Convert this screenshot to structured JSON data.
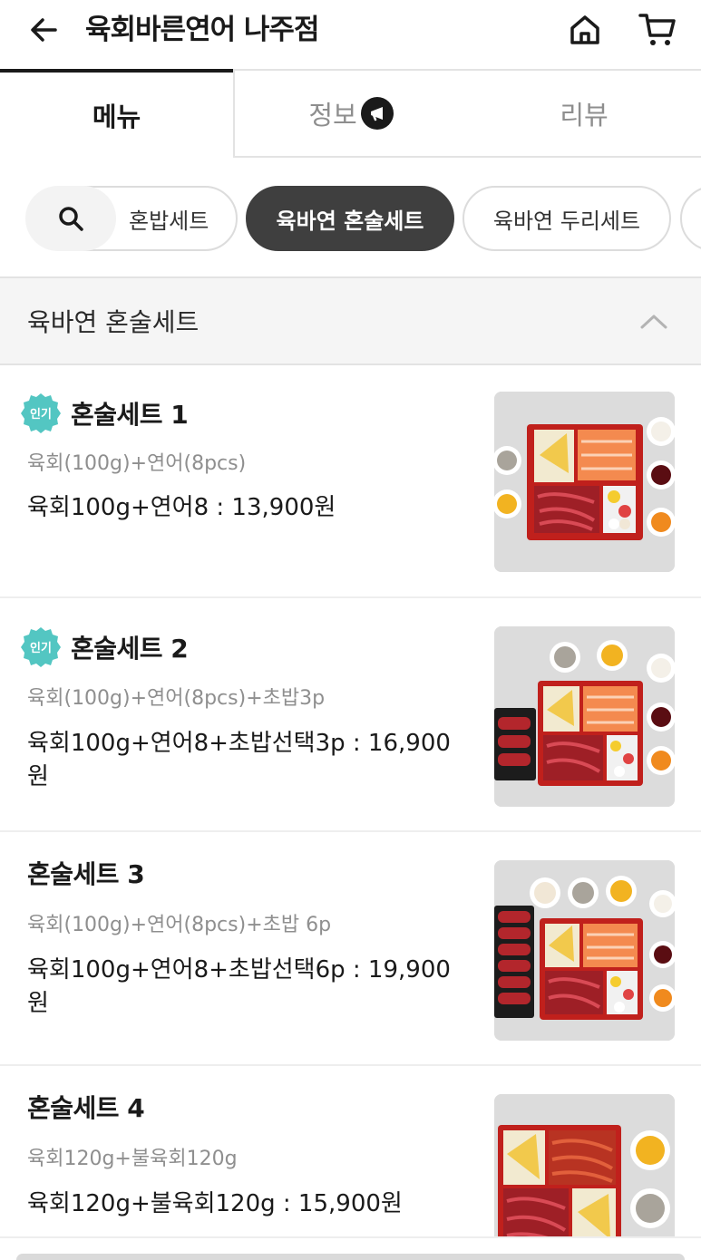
{
  "header": {
    "title": "육회바른연어 나주점"
  },
  "tabs": [
    {
      "label": "메뉴"
    },
    {
      "label": "정보"
    },
    {
      "label": "리뷰"
    }
  ],
  "chips": [
    {
      "label": "혼밥세트"
    },
    {
      "label": "육바연 혼술세트"
    },
    {
      "label": "육바연 두리세트"
    }
  ],
  "section": {
    "title": "육바연 혼술세트"
  },
  "badge": {
    "label": "인기",
    "color": "#53c6c2"
  },
  "items": [
    {
      "name": "혼술세트 1",
      "popular": true,
      "desc": "육회(100g)+연어(8pcs)",
      "price": "육회100g+연어8 : 13,900원"
    },
    {
      "name": "혼술세트 2",
      "popular": true,
      "desc": "육회(100g)+연어(8pcs)+초밥3p",
      "price": "육회100g+연어8+초밥선택3p : 16,900원"
    },
    {
      "name": "혼술세트 3",
      "popular": false,
      "desc": "육회(100g)+연어(8pcs)+초밥 6p",
      "price": "육회100g+연어8+초밥선택6p : 19,900원"
    },
    {
      "name": "혼술세트 4",
      "popular": false,
      "desc": "육회120g+불육회120g",
      "price": "육회120g+불육회120g : 15,900원"
    }
  ],
  "icons": {
    "back": "arrow-left-icon",
    "home": "home-icon",
    "cart": "cart-icon",
    "info_badge": "megaphone-icon",
    "search": "search-icon",
    "collapse": "chevron-up-icon"
  }
}
